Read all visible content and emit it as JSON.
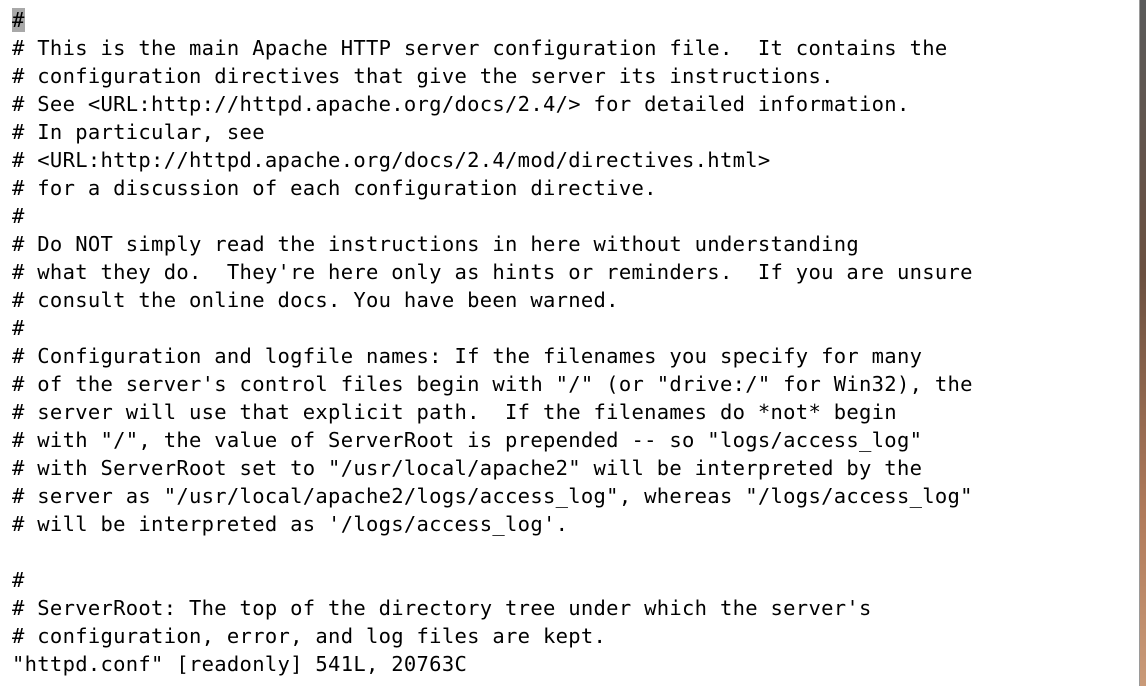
{
  "editor": {
    "lines": [
      "#",
      "# This is the main Apache HTTP server configuration file.  It contains the",
      "# configuration directives that give the server its instructions.",
      "# See <URL:http://httpd.apache.org/docs/2.4/> for detailed information.",
      "# In particular, see",
      "# <URL:http://httpd.apache.org/docs/2.4/mod/directives.html>",
      "# for a discussion of each configuration directive.",
      "#",
      "# Do NOT simply read the instructions in here without understanding",
      "# what they do.  They're here only as hints or reminders.  If you are unsure",
      "# consult the online docs. You have been warned.",
      "#",
      "# Configuration and logfile names: If the filenames you specify for many",
      "# of the server's control files begin with \"/\" (or \"drive:/\" for Win32), the",
      "# server will use that explicit path.  If the filenames do *not* begin",
      "# with \"/\", the value of ServerRoot is prepended -- so \"logs/access_log\"",
      "# with ServerRoot set to \"/usr/local/apache2\" will be interpreted by the",
      "# server as \"/usr/local/apache2/logs/access_log\", whereas \"/logs/access_log\"",
      "# will be interpreted as '/logs/access_log'.",
      "",
      "#",
      "# ServerRoot: The top of the directory tree under which the server's",
      "# configuration, error, and log files are kept."
    ],
    "status_line": "\"httpd.conf\" [readonly] 541L, 20763C"
  }
}
